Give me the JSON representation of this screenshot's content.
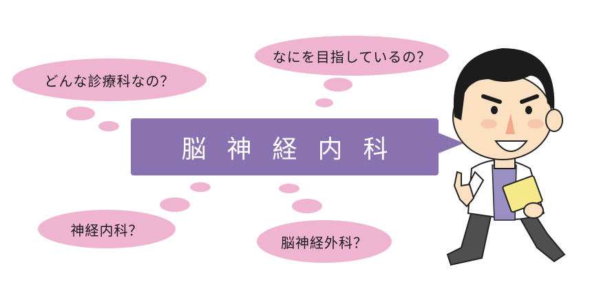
{
  "main_label": "脳神経内科",
  "bubbles": {
    "q1": "どんな診療科なの？",
    "q2": "なにを目指しているの？",
    "q3": "神経内科？",
    "q4": "脳神経外科？"
  },
  "colors": {
    "bubble": "#efb4cf",
    "main_box": "#8a72b0",
    "main_text": "#ffffff"
  },
  "illustration": "doctor-character"
}
